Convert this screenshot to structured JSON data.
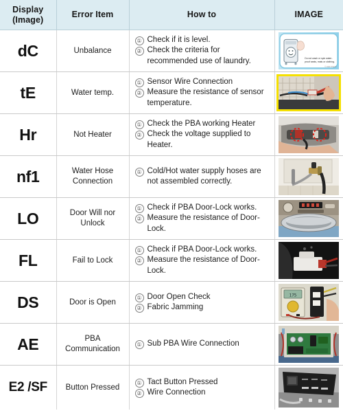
{
  "table": {
    "headers": [
      {
        "id": "display",
        "label": "Display\n(Image)",
        "line1": "Display",
        "line2": "(Image)"
      },
      {
        "id": "error_item",
        "label": "Error Item"
      },
      {
        "id": "how_to",
        "label": "How to"
      },
      {
        "id": "image",
        "label": "IMAGE"
      }
    ],
    "header_bg": "#dcecf2",
    "rows": [
      {
        "display": "dC",
        "error_item": "Unbalance",
        "how_to": [
          {
            "num": "①",
            "text": "Check if it is level."
          },
          {
            "num": "②",
            "text": "Check the criteria for recommended use of laundry."
          }
        ],
        "image": {
          "name": "washer-cartoon-warning-illustration",
          "caption": "Do not wash or spin water-proof seats, mats or clothing.",
          "credit": "© 0441733e01"
        }
      },
      {
        "display": "tE",
        "error_item": "Water temp.",
        "how_to": [
          {
            "num": "①",
            "text": "Sensor Wire Connection"
          },
          {
            "num": "②",
            "text": "Measure the resistance of sensor temperature."
          }
        ],
        "image": {
          "name": "sensor-wiring-photo-yellow-frame",
          "caption": "",
          "credit": ""
        }
      },
      {
        "display": "Hr",
        "error_item": "Not Heater",
        "how_to": [
          {
            "num": "①",
            "text": "Check the PBA working Heater"
          },
          {
            "num": "②",
            "text": "Check the voltage supplied to Heater."
          }
        ],
        "image": {
          "name": "heater-terminals-photo",
          "caption": "",
          "credit": ""
        }
      },
      {
        "display": "nf1",
        "error_item": "Water Hose Connection",
        "how_to": [
          {
            "num": "①",
            "text": "Cold/Hot water supply hoses are not assembled correctly."
          }
        ],
        "image": {
          "name": "water-supply-hose-photo",
          "caption": "",
          "credit": ""
        }
      },
      {
        "display": "LO",
        "error_item": "Door Will nor Unlock",
        "how_to": [
          {
            "num": "①",
            "text": "Check if PBA Door-Lock works."
          },
          {
            "num": "②",
            "text": "Measure the resistance of Door-Lock."
          }
        ],
        "image": {
          "name": "washer-control-panel-door-photo",
          "caption": "",
          "credit": ""
        }
      },
      {
        "display": "FL",
        "error_item": "Fail to Lock",
        "how_to": [
          {
            "num": "①",
            "text": "Check if PBA Door-Lock works."
          },
          {
            "num": "②",
            "text": "Measure the resistance of Door-Lock."
          }
        ],
        "image": {
          "name": "door-lock-assembly-photo",
          "caption": "",
          "credit": ""
        }
      },
      {
        "display": "DS",
        "error_item": "Door is Open",
        "how_to": [
          {
            "num": "①",
            "text": "Door Open Check"
          },
          {
            "num": "②",
            "text": "Fabric Jamming"
          }
        ],
        "image": {
          "name": "multimeter-door-switch-photo",
          "caption": "",
          "credit": ""
        }
      },
      {
        "display": "AE",
        "error_item": "PBA Communication",
        "how_to": [
          {
            "num": "①",
            "text": "Sub PBA Wire Connection"
          }
        ],
        "image": {
          "name": "main-pcb-board-photo",
          "caption": "",
          "credit": ""
        }
      },
      {
        "display": "E2 /SF",
        "error_item": "Button Pressed",
        "how_to": [
          {
            "num": "①",
            "text": "Tact Button Pressed"
          },
          {
            "num": "②",
            "text": "Wire Connection"
          }
        ],
        "image": {
          "name": "control-panel-tact-buttons-photo",
          "caption": "",
          "credit": ""
        }
      }
    ]
  }
}
